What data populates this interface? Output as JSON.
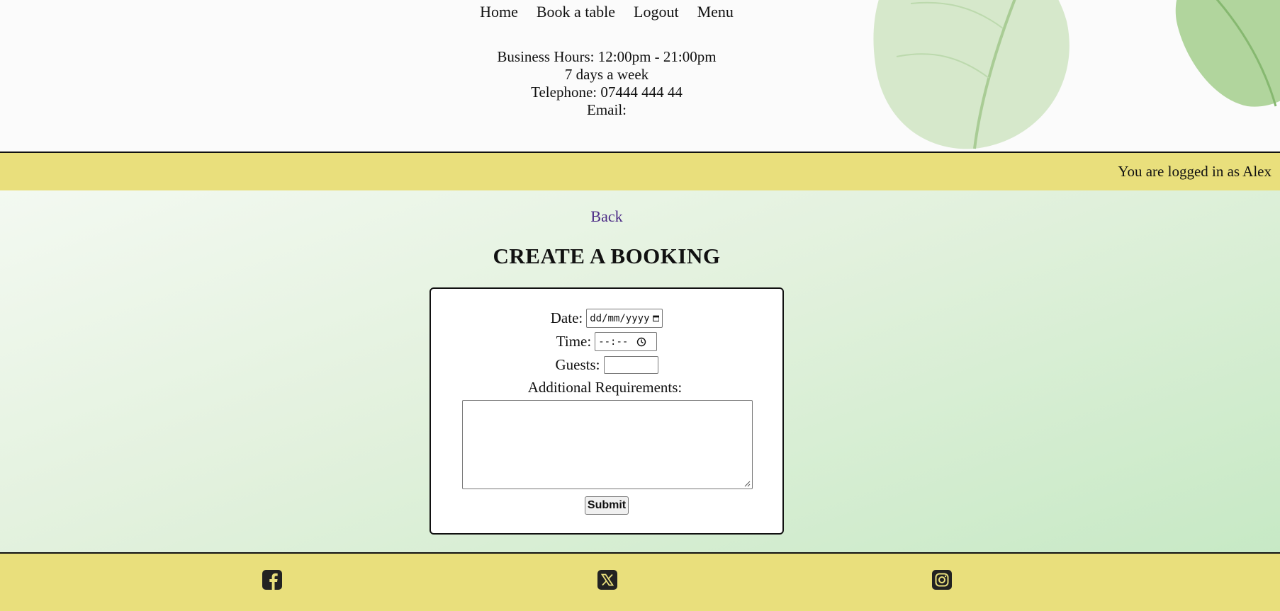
{
  "nav": {
    "items": [
      "Home",
      "Book a table",
      "Logout",
      "Menu"
    ]
  },
  "info": {
    "hours": "Business Hours: 12:00pm - 21:00pm",
    "days": "7 days a week",
    "telephone": "Telephone: 07444 444 44",
    "email": "Email:"
  },
  "status": {
    "logged_in": "You are logged in as Alex"
  },
  "main": {
    "back_label": "Back",
    "title": "CREATE A BOOKING"
  },
  "form": {
    "date_label": "Date:",
    "date_value": "dd/mm/yyyy",
    "time_label": "Time:",
    "time_value": "--:--",
    "guests_label": "Guests:",
    "guests_value": "",
    "requirements_label": "Additional Requirements:",
    "requirements_value": "",
    "submit_label": "Submit"
  },
  "footer": {
    "icons": [
      "facebook-icon",
      "x-icon",
      "instagram-icon"
    ]
  },
  "colors": {
    "bar": "#e9df7c",
    "link": "#4b2a86",
    "main_gradient_end": "#c7e9c5"
  }
}
